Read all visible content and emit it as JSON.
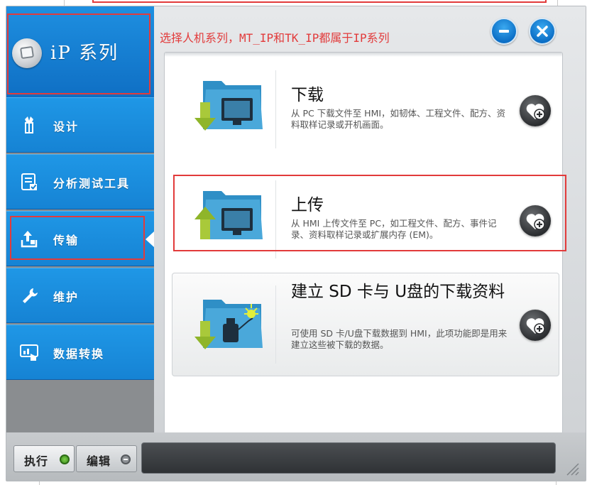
{
  "annotation": "选择人机系列，MT_IP和TK_IP都属于IP系列",
  "brand": {
    "title": "iP 系列",
    "logo_icon": "ip-logo-icon"
  },
  "window_buttons": {
    "minimize_icon": "minimize-icon",
    "close_icon": "close-icon"
  },
  "sidebar": {
    "items": [
      {
        "id": "design",
        "label": "设计",
        "icon": "design-icon"
      },
      {
        "id": "analysis",
        "label": "分析测试工具",
        "icon": "checklist-icon"
      },
      {
        "id": "transfer",
        "label": "传输",
        "icon": "upload-icon",
        "selected": true
      },
      {
        "id": "maintenance",
        "label": "维护",
        "icon": "wrench-icon"
      },
      {
        "id": "convert",
        "label": "数据转换",
        "icon": "data-convert-icon"
      }
    ]
  },
  "main": {
    "cards": [
      {
        "id": "download",
        "title": "下载",
        "desc": "从 PC 下载文件至 HMI，如韧体、工程文件、配方、资料取样记录或开机画面。",
        "icon": "download-folder-icon",
        "action_icon": "add-circle-icon"
      },
      {
        "id": "upload",
        "title": "上传",
        "desc": "从 HMI 上传文件至 PC，如工程文件、配方、事件记录、资料取样记录或扩展内存 (EM)。",
        "icon": "upload-folder-icon",
        "action_icon": "add-circle-icon",
        "highlighted": true
      },
      {
        "id": "sdcard",
        "title": "建立 SD 卡与 U盘的下载资料",
        "desc": "可使用 SD 卡/U盘下载数据到 HMI，此项功能即是用来建立这些被下载的数据。",
        "icon": "usb-folder-icon",
        "action_icon": "add-circle-icon"
      }
    ]
  },
  "footer": {
    "run_label": "执行",
    "edit_label": "编辑",
    "colors": {
      "run_dot": "#4aa02c",
      "edit_dot": "#6b6f73"
    }
  },
  "colors": {
    "accent": "#1683d4",
    "annotation": "#e23b3b"
  }
}
